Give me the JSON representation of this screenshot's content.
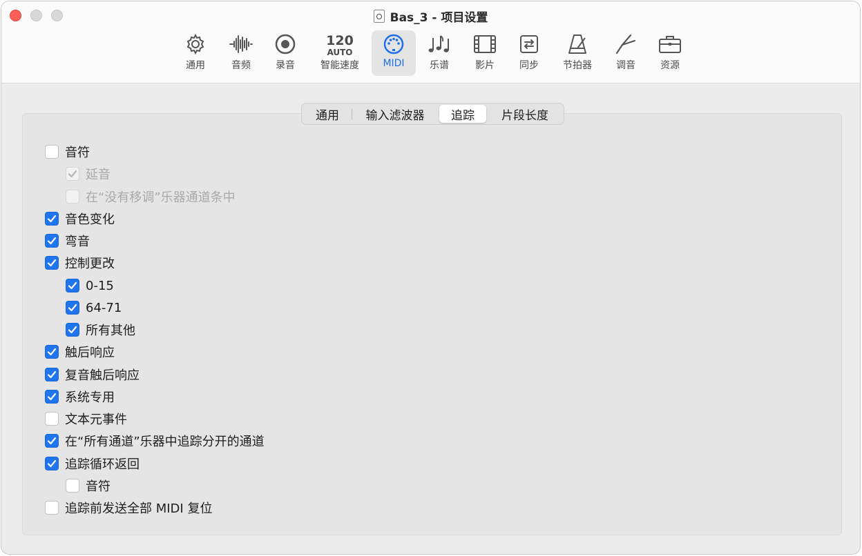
{
  "window": {
    "title": "Bas_3 - 项目设置"
  },
  "toolbar": {
    "tabs": [
      {
        "id": "general",
        "label": "通用",
        "icon": "gear-icon"
      },
      {
        "id": "audio",
        "label": "音频",
        "icon": "waveform-icon"
      },
      {
        "id": "recording",
        "label": "录音",
        "icon": "record-icon"
      },
      {
        "id": "tempo",
        "label": "智能速度",
        "icon": "tempo-icon",
        "icon_text_top": "120",
        "icon_text_bottom": "AUTO"
      },
      {
        "id": "midi",
        "label": "MIDI",
        "icon": "midi-port-icon",
        "active": true
      },
      {
        "id": "score",
        "label": "乐谱",
        "icon": "music-notes-icon"
      },
      {
        "id": "movie",
        "label": "影片",
        "icon": "film-icon"
      },
      {
        "id": "sync",
        "label": "同步",
        "icon": "sync-icon"
      },
      {
        "id": "metronome",
        "label": "节拍器",
        "icon": "metronome-icon"
      },
      {
        "id": "tuning",
        "label": "调音",
        "icon": "tuning-fork-icon"
      },
      {
        "id": "assets",
        "label": "资源",
        "icon": "briefcase-icon"
      }
    ]
  },
  "segmented": {
    "items": [
      {
        "label": "通用"
      },
      {
        "label": "输入滤波器"
      },
      {
        "label": "追踪",
        "active": true
      },
      {
        "label": "片段长度"
      }
    ]
  },
  "options": [
    {
      "label": "音符",
      "checked": false,
      "indent": 0,
      "disabled": false
    },
    {
      "label": "延音",
      "checked": true,
      "indent": 1,
      "disabled": true
    },
    {
      "label": "在“没有移调”乐器通道条中",
      "checked": false,
      "indent": 1,
      "disabled": true
    },
    {
      "label": "音色变化",
      "checked": true,
      "indent": 0,
      "disabled": false
    },
    {
      "label": "弯音",
      "checked": true,
      "indent": 0,
      "disabled": false
    },
    {
      "label": "控制更改",
      "checked": true,
      "indent": 0,
      "disabled": false
    },
    {
      "label": "0-15",
      "checked": true,
      "indent": 1,
      "disabled": false
    },
    {
      "label": "64-71",
      "checked": true,
      "indent": 1,
      "disabled": false
    },
    {
      "label": "所有其他",
      "checked": true,
      "indent": 1,
      "disabled": false
    },
    {
      "label": "触后响应",
      "checked": true,
      "indent": 0,
      "disabled": false
    },
    {
      "label": "复音触后响应",
      "checked": true,
      "indent": 0,
      "disabled": false
    },
    {
      "label": "系统专用",
      "checked": true,
      "indent": 0,
      "disabled": false
    },
    {
      "label": "文本元事件",
      "checked": false,
      "indent": 0,
      "disabled": false
    },
    {
      "label": "在“所有通道”乐器中追踪分开的通道",
      "checked": true,
      "indent": 0,
      "disabled": false
    },
    {
      "label": "追踪循环返回",
      "checked": true,
      "indent": 0,
      "disabled": false
    },
    {
      "label": "音符",
      "checked": false,
      "indent": 1,
      "disabled": false
    },
    {
      "label": "追踪前发送全部 MIDI 复位",
      "checked": false,
      "indent": 0,
      "disabled": false
    }
  ],
  "colors": {
    "accent": "#1f75ee",
    "close": "#fe5f57"
  }
}
